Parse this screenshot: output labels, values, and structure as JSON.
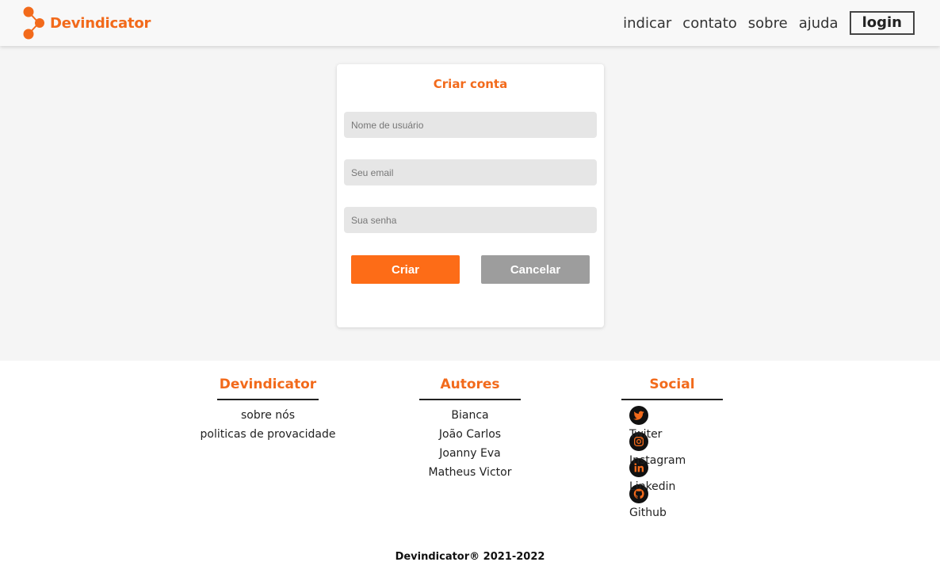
{
  "header": {
    "brand": "Devindicator",
    "nav": [
      {
        "label": "indicar"
      },
      {
        "label": "contato"
      },
      {
        "label": "sobre"
      },
      {
        "label": "ajuda"
      }
    ],
    "login_label": "login"
  },
  "form": {
    "title": "Criar conta",
    "username_placeholder": "Nome de usuário",
    "email_placeholder": "Seu email",
    "password_placeholder": "Sua senha",
    "submit_label": "Criar",
    "cancel_label": "Cancelar"
  },
  "footer": {
    "brand_col": {
      "title": "Devindicator",
      "links": [
        "sobre nós",
        "politicas de provacidade"
      ]
    },
    "authors_col": {
      "title": "Autores",
      "names": [
        "Bianca",
        "João Carlos",
        "Joanny Eva",
        "Matheus Victor"
      ]
    },
    "social_col": {
      "title": "Social",
      "links": [
        {
          "label": "Twiter",
          "icon": "twitter-icon"
        },
        {
          "label": "Instagram",
          "icon": "instagram-icon"
        },
        {
          "label": "Linkedin",
          "icon": "linkedin-icon"
        },
        {
          "label": "Github",
          "icon": "github-icon"
        }
      ]
    },
    "copyright": "Devindicator® 2021-2022"
  },
  "colors": {
    "accent": "#f26a1b",
    "primary_button": "#fd6c17",
    "secondary_button": "#9d9d9d",
    "field_bg": "#e6e6e6",
    "page_bg": "#f5f5f5"
  }
}
